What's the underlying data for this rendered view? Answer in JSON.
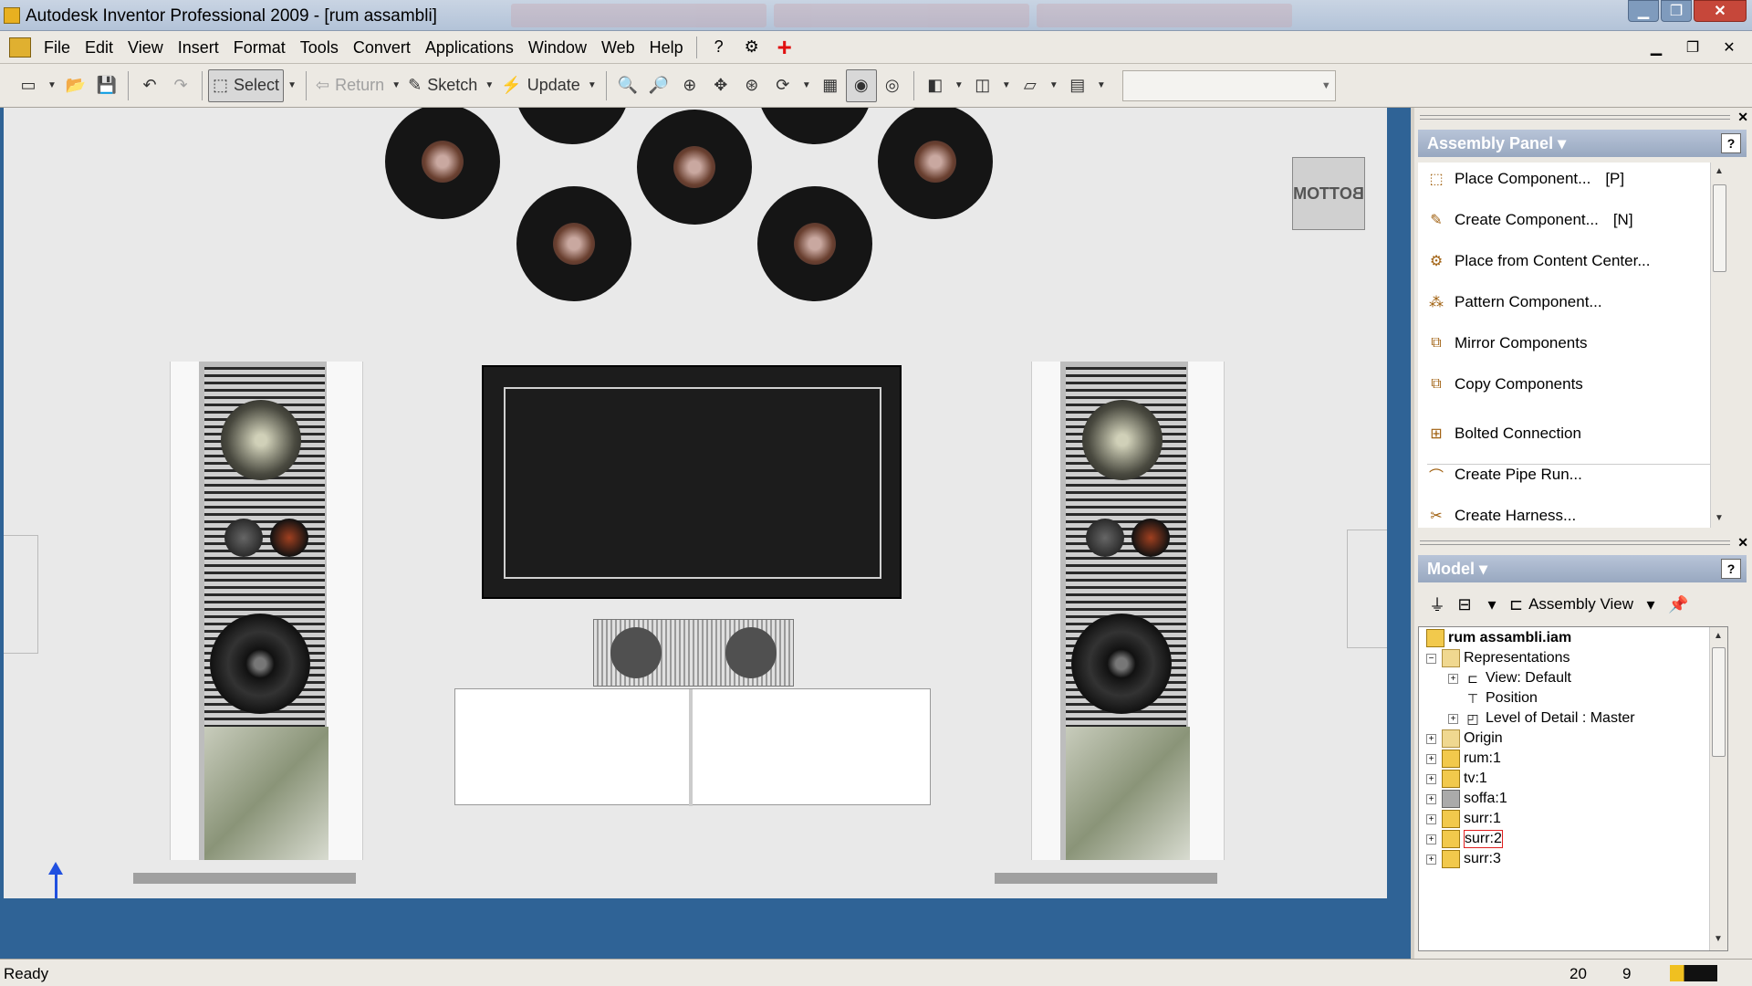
{
  "titlebar": {
    "title": "Autodesk Inventor Professional 2009 - [rum assambli]",
    "minimize": "▁",
    "restore": "❐",
    "close": "✕"
  },
  "menubar": {
    "items": [
      "File",
      "Edit",
      "View",
      "Insert",
      "Format",
      "Tools",
      "Convert",
      "Applications",
      "Window",
      "Web",
      "Help"
    ],
    "help_icon": "?",
    "plus_icon": "+",
    "doc_minimize": "▁",
    "doc_restore": "❐",
    "doc_close": "✕"
  },
  "toolbar": {
    "select_label": "Select",
    "return_label": "Return",
    "sketch_label": "Sketch",
    "update_label": "Update",
    "combo_value": ""
  },
  "viewport": {
    "view_cube_label": "BOTTOM",
    "background_color": "#2f6396",
    "canvas_color": "#e9e9e9"
  },
  "assembly_panel": {
    "title": "Assembly Panel ▾",
    "help": "?",
    "commands": [
      {
        "label": "Place Component...",
        "hotkey": "[P]"
      },
      {
        "label": "Create Component...",
        "hotkey": "[N]"
      },
      {
        "label": "Place from Content Center...",
        "hotkey": ""
      },
      {
        "label": "Pattern Component...",
        "hotkey": ""
      },
      {
        "label": "Mirror Components",
        "hotkey": ""
      },
      {
        "label": "Copy Components",
        "hotkey": ""
      },
      {
        "label": "Bolted Connection",
        "hotkey": ""
      },
      {
        "label": "Create Pipe Run...",
        "hotkey": ""
      },
      {
        "label": "Create Harness...",
        "hotkey": ""
      }
    ]
  },
  "model_panel": {
    "title": "Model ▾",
    "help": "?",
    "view_label": "Assembly View",
    "tree": {
      "root": "rum assambli.iam",
      "representations": "Representations",
      "view_default": "View: Default",
      "position": "Position",
      "level_of_detail": "Level of Detail : Master",
      "origin": "Origin",
      "rum": "rum:1",
      "tv": "tv:1",
      "soffa": "soffa:1",
      "surr1": "surr:1",
      "surr2": "surr:2",
      "surr3": "surr:3"
    }
  },
  "statusbar": {
    "status": "Ready",
    "count1": "20",
    "count2": "9"
  }
}
